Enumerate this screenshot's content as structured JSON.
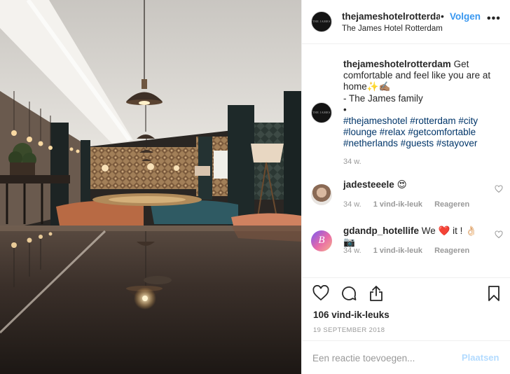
{
  "post": {
    "image_alt": "Restaurant interior with pendant lamps reflected in a polished table",
    "header": {
      "username": "thejameshotelrotterdam",
      "dot": "•",
      "follow_label": "Volgen",
      "location": "The James Hotel Rotterdam",
      "more_label": "•••",
      "avatar_text": "THE JAMES"
    },
    "caption": {
      "username": "thejameshotelrotterdam",
      "text": "Get comfortable and feel like you are at home✨✍🏽",
      "signature": "- The James family",
      "bullet": "•",
      "hashtags": "#thejameshotel #rotterdam #city #lounge #relax #getcomfortable #netherlands #guests #stayover",
      "time": "34 w."
    },
    "comments": [
      {
        "username": "jadesteeele",
        "text": "😍",
        "time": "34 w.",
        "likes": "",
        "reply_label": "Reageren"
      },
      {
        "username": "gdandp_hotellife",
        "text": "We ❤️ it ! 👌🏻📷",
        "time": "34 w.",
        "likes": "1 vind-ik-leuk",
        "reply_label": "Reageren",
        "avatar_letter": "B"
      }
    ],
    "comment1_likes": "1 vind-ik-leuk",
    "likes_count": "106 vind-ik-leuks",
    "date": "19 SEPTEMBER 2018",
    "add_comment": {
      "placeholder": "Een reactie toevoegen...",
      "post_label": "Plaatsen"
    }
  },
  "icons": [
    "heart-outline-icon",
    "comment-icon",
    "share-icon",
    "bookmark-icon",
    "small-heart-icon"
  ],
  "colors": {
    "link": "#3897f0",
    "hashtag": "#003569",
    "muted": "#999999",
    "post_disabled": "#b3dbff",
    "border": "#efefef"
  }
}
